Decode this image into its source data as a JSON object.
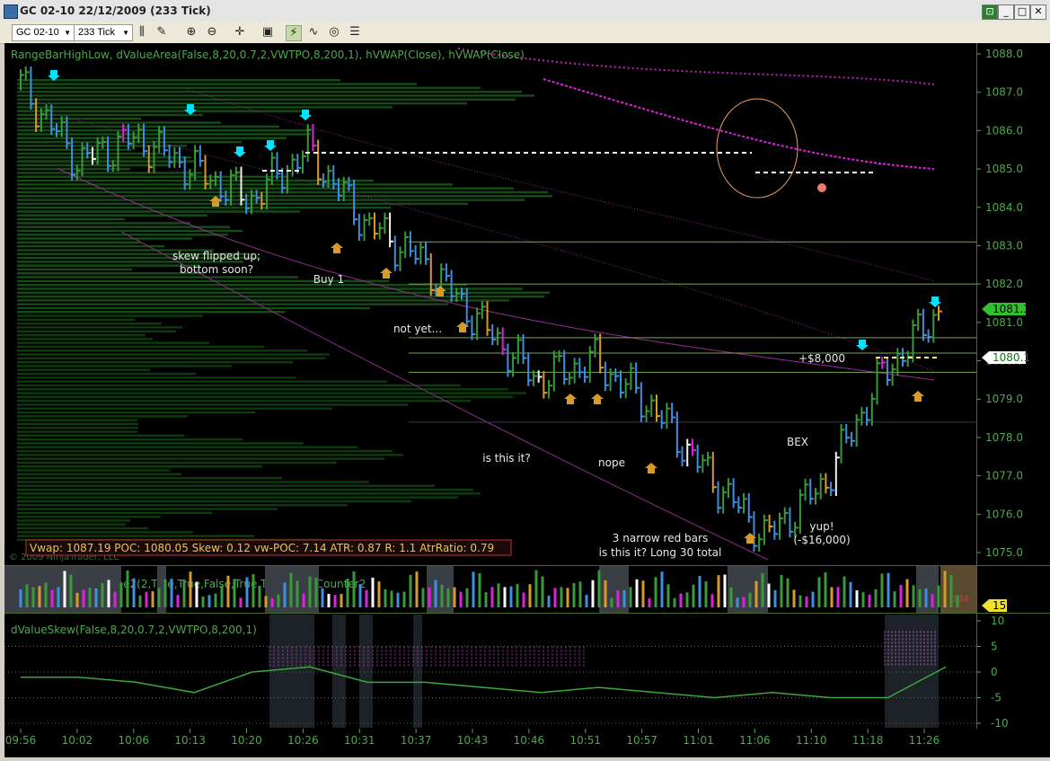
{
  "window": {
    "title": "GC 02-10  22/12/2009 (233 Tick)"
  },
  "toolbar": {
    "instrument": "GC 02-10",
    "period": "233 Tick"
  },
  "panels": {
    "price_label": "RangeBarHighLow, dValueArea(False,8,20,0.7,2,VWTPO,8,200,1), hVWAP(Close), hVWAP(Close)",
    "volume_label": "RPM(6), BetterVolume2(2,True,True,False,True,True), TickCounter2",
    "skew_label": "dValueSkew(False,8,20,0.7,2,VWTPO,8,200,1)",
    "copyright": "© 2009 NinjaTrader, LLC",
    "stats_box": "Vwap: 1087.19 POC: 1080.05 Skew: 0.12 vw-POC: 7.14 ATR: 0.87 R: 1.1 AtrRatio: 0.79",
    "tick_count": "134"
  },
  "annotations": {
    "skew_flip": "skew flipped up;",
    "bottom_soon": "bottom soon?",
    "buy1": "Buy 1",
    "not_yet": "not yet...",
    "is_this_it": "is this it?",
    "nope": "nope",
    "three_red_1": "3 narrow red bars",
    "three_red_2": "is this it? Long 30 total",
    "bex": "BEX",
    "plus8000": "+$8,000",
    "yup": "yup!",
    "minus16000": "(-$16,000)"
  },
  "price_axis": {
    "ticks": [
      "1088.0",
      "1087.0",
      "1086.0",
      "1085.0",
      "1084.0",
      "1083.0",
      "1082.0",
      "1081.0",
      "1080.0",
      "1079.0",
      "1078.0",
      "1077.0",
      "1076.0",
      "1075.0"
    ],
    "last_price": "1081.3",
    "ref_price": "1080.1"
  },
  "volume_axis": {
    "marker": "15"
  },
  "skew_axis": {
    "ticks": [
      "10",
      "5",
      "0",
      "-5",
      "-10"
    ]
  },
  "time_axis": {
    "ticks": [
      "09:56",
      "10:02",
      "10:06",
      "10:13",
      "10:20",
      "10:26",
      "10:31",
      "10:37",
      "10:43",
      "10:46",
      "10:51",
      "10:57",
      "11:01",
      "11:06",
      "11:10",
      "11:18",
      "11:26"
    ]
  },
  "colors": {
    "background": "#000000",
    "up_bar": "#3a9a3a",
    "down_bar": "#3d8fe0",
    "gold_bar": "#d89a2c",
    "magenta": "#e020e0",
    "cyan_arrow": "#00e5ff",
    "level_line": "#7aa84a"
  },
  "chart_data": {
    "type": "line",
    "title": "",
    "xlabel": "",
    "ylabel": "",
    "ylim": [
      1074.9,
      1088.1
    ],
    "x": [
      "09:56",
      "10:02",
      "10:06",
      "10:13",
      "10:20",
      "10:26",
      "10:31",
      "10:37",
      "10:43",
      "10:46",
      "10:51",
      "10:57",
      "11:01",
      "11:06",
      "11:10",
      "11:18",
      "11:26"
    ],
    "series": [
      {
        "name": "",
        "values": [
          1087.2,
          1085.2,
          1085.8,
          1085.0,
          1084.2,
          1085.5,
          1083.6,
          1082.6,
          1081.0,
          1079.5,
          1080.0,
          1078.8,
          1077.0,
          1075.4,
          1076.8,
          1079.6,
          1081.3
        ]
      }
    ],
    "price_levels": [
      1083.1,
      1082.0,
      1080.6,
      1080.2,
      1079.7,
      1078.4
    ],
    "skew": {
      "ylim": [
        -10,
        10
      ],
      "values": [
        -1,
        -1,
        -2,
        -4,
        0,
        1,
        -2,
        -2,
        -3,
        -4,
        -3,
        -4,
        -5,
        -4,
        -5,
        -5,
        1
      ]
    }
  }
}
